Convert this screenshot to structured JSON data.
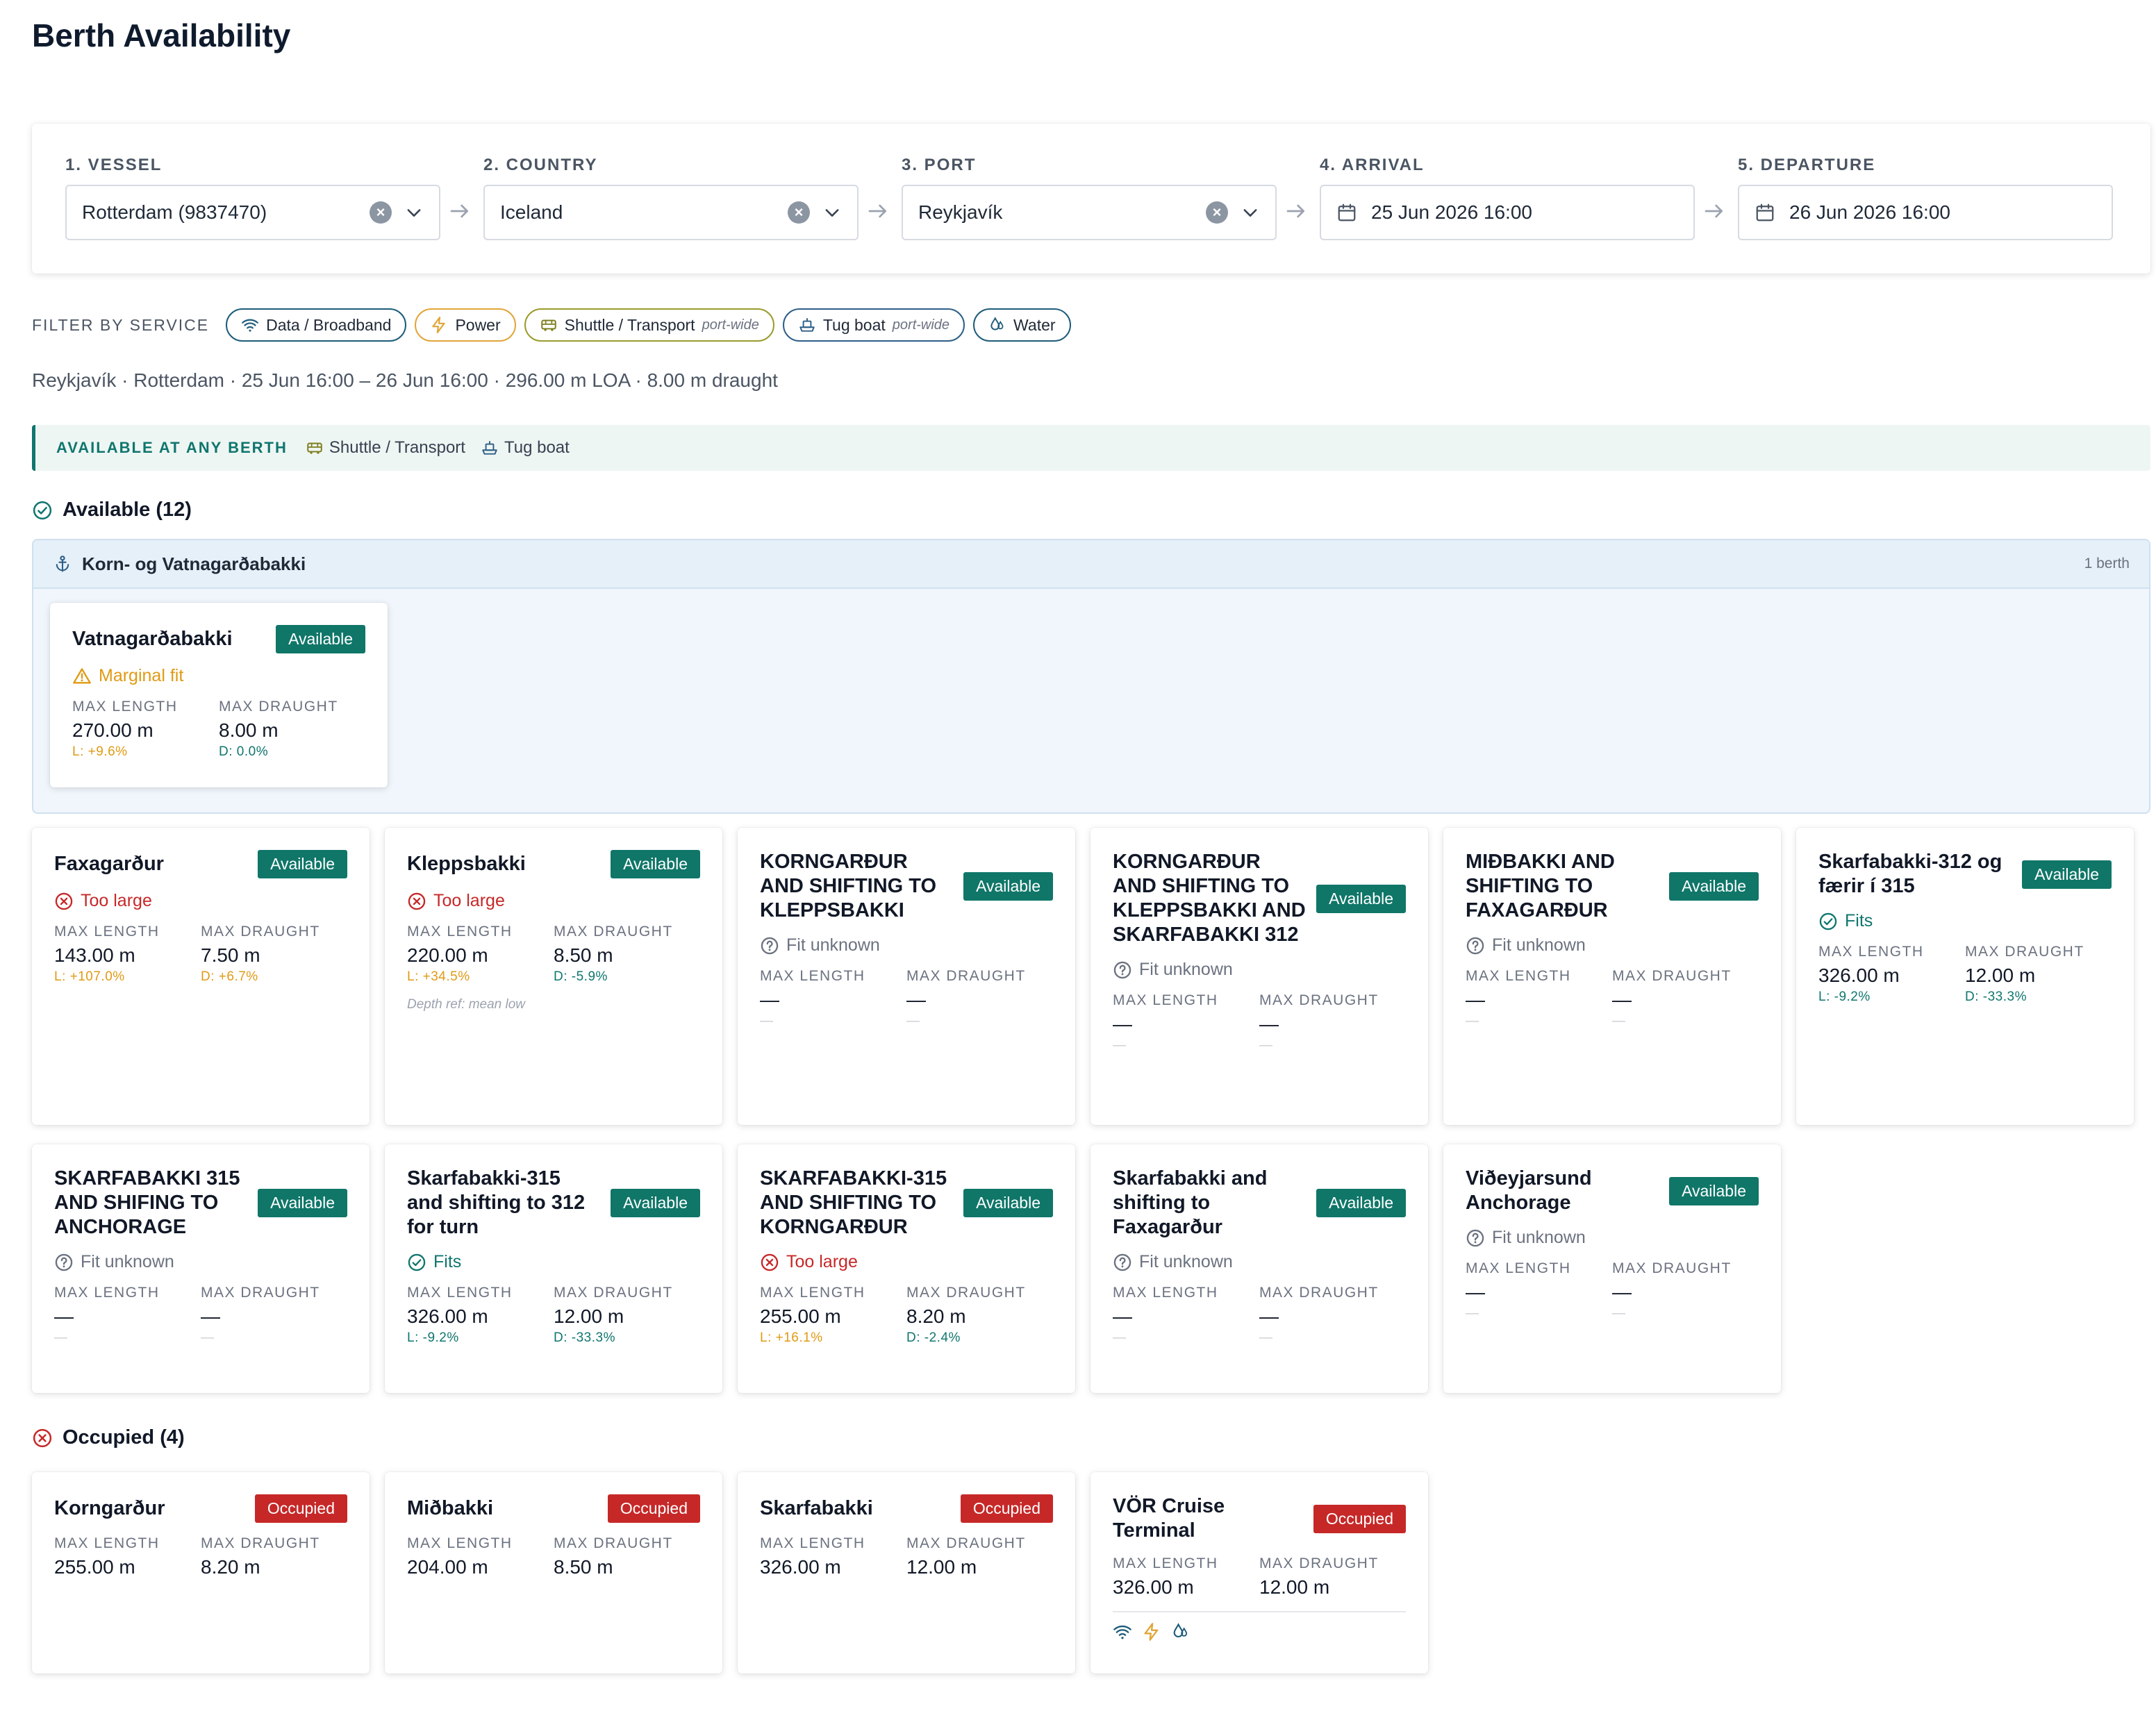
{
  "page": {
    "title": "Berth Availability"
  },
  "steps": [
    {
      "label": "1. VESSEL",
      "value": "Rotterdam (9837470)"
    },
    {
      "label": "2. COUNTRY",
      "value": "Iceland"
    },
    {
      "label": "3. PORT",
      "value": "Reykjavík"
    },
    {
      "label": "4. ARRIVAL",
      "value": "25 Jun 2026 16:00"
    },
    {
      "label": "5. DEPARTURE",
      "value": "26 Jun 2026 16:00"
    }
  ],
  "filter": {
    "label": "FILTER BY SERVICE",
    "chips": [
      {
        "label": "Data / Broadband",
        "icon": "wifi-icon"
      },
      {
        "label": "Power",
        "icon": "lightning-icon"
      },
      {
        "label": "Shuttle / Transport",
        "icon": "bus-icon",
        "note": "port-wide"
      },
      {
        "label": "Tug boat",
        "icon": "ship-icon",
        "note": "port-wide"
      },
      {
        "label": "Water",
        "icon": "water-drop-icon"
      }
    ]
  },
  "summary": "Reykjavík · Rotterdam · 25 Jun 16:00 – 26 Jun 16:00 · 296.00 m LOA · 8.00 m draught",
  "any_berth": {
    "label": "AVAILABLE AT ANY BERTH",
    "items": [
      {
        "label": "Shuttle / Transport",
        "icon": "bus-icon"
      },
      {
        "label": "Tug boat",
        "icon": "ship-icon"
      }
    ]
  },
  "available": {
    "heading": "Available (12)",
    "group": {
      "title": "Korn- og Vatnagarðabakki",
      "count": "1 berth",
      "card": {
        "name": "Vatnagarðabakki",
        "badge": "Available",
        "fit": "Marginal fit",
        "len_label": "MAX LENGTH",
        "len": "270.00 m",
        "len_delta": "L: +9.6%",
        "dr_label": "MAX DRAUGHT",
        "dr": "8.00 m",
        "dr_delta": "D: 0.0%"
      }
    },
    "cards": [
      {
        "name": "Faxagarður",
        "badge": "Available",
        "fit": "Too large",
        "len_label": "MAX LENGTH",
        "len": "143.00 m",
        "len_delta": "L: +107.0%",
        "dr_label": "MAX DRAUGHT",
        "dr": "7.50 m",
        "dr_delta": "D: +6.7%"
      },
      {
        "name": "Kleppsbakki",
        "badge": "Available",
        "fit": "Too large",
        "len_label": "MAX LENGTH",
        "len": "220.00 m",
        "len_delta": "L: +34.5%",
        "dr_label": "MAX DRAUGHT",
        "dr": "8.50 m",
        "dr_delta": "D: -5.9%",
        "depth_ref": "Depth ref: mean low"
      },
      {
        "name": "KORNGARÐUR AND SHIFTING TO KLEPPSBAKKI",
        "badge": "Available",
        "fit": "Fit unknown",
        "len_label": "MAX LENGTH",
        "len": "—",
        "len_delta": "—",
        "dr_label": "MAX DRAUGHT",
        "dr": "—",
        "dr_delta": "—"
      },
      {
        "name": "KORNGARÐUR AND SHIFTING TO KLEPPSBAKKI AND SKARFABAKKI 312",
        "badge": "Available",
        "fit": "Fit unknown",
        "len_label": "MAX LENGTH",
        "len": "—",
        "len_delta": "—",
        "dr_label": "MAX DRAUGHT",
        "dr": "—",
        "dr_delta": "—"
      },
      {
        "name": "MIÐBAKKI AND SHIFTING TO FAXAGARÐUR",
        "badge": "Available",
        "fit": "Fit unknown",
        "len_label": "MAX LENGTH",
        "len": "—",
        "len_delta": "—",
        "dr_label": "MAX DRAUGHT",
        "dr": "—",
        "dr_delta": "—"
      },
      {
        "name": "Skarfabakki-312 og færir í 315",
        "badge": "Available",
        "fit": "Fits",
        "len_label": "MAX LENGTH",
        "len": "326.00 m",
        "len_delta": "L: -9.2%",
        "dr_label": "MAX DRAUGHT",
        "dr": "12.00 m",
        "dr_delta": "D: -33.3%"
      },
      {
        "name": "SKARFABAKKI 315 AND SHIFING TO ANCHORAGE",
        "badge": "Available",
        "fit": "Fit unknown",
        "len_label": "MAX LENGTH",
        "len": "—",
        "len_delta": "—",
        "dr_label": "MAX DRAUGHT",
        "dr": "—",
        "dr_delta": "—"
      },
      {
        "name": "Skarfabakki-315 and shifting to 312 for turn",
        "badge": "Available",
        "fit": "Fits",
        "len_label": "MAX LENGTH",
        "len": "326.00 m",
        "len_delta": "L: -9.2%",
        "dr_label": "MAX DRAUGHT",
        "dr": "12.00 m",
        "dr_delta": "D: -33.3%"
      },
      {
        "name": "SKARFABAKKI-315 AND SHIFTING TO KORNGARÐUR",
        "badge": "Available",
        "fit": "Too large",
        "len_label": "MAX LENGTH",
        "len": "255.00 m",
        "len_delta": "L: +16.1%",
        "dr_label": "MAX DRAUGHT",
        "dr": "8.20 m",
        "dr_delta": "D: -2.4%"
      },
      {
        "name": "Skarfabakki and shifting to Faxagarður",
        "badge": "Available",
        "fit": "Fit unknown",
        "len_label": "MAX LENGTH",
        "len": "—",
        "len_delta": "—",
        "dr_label": "MAX DRAUGHT",
        "dr": "—",
        "dr_delta": "—"
      },
      {
        "name": "Viðeyjarsund Anchorage",
        "badge": "Available",
        "fit": "Fit unknown",
        "len_label": "MAX LENGTH",
        "len": "—",
        "len_delta": "—",
        "dr_label": "MAX DRAUGHT",
        "dr": "—",
        "dr_delta": "—"
      }
    ]
  },
  "occupied": {
    "heading": "Occupied (4)",
    "cards": [
      {
        "name": "Korngarður",
        "badge": "Occupied",
        "len_label": "MAX LENGTH",
        "len": "255.00 m",
        "dr_label": "MAX DRAUGHT",
        "dr": "8.20 m"
      },
      {
        "name": "Miðbakki",
        "badge": "Occupied",
        "len_label": "MAX LENGTH",
        "len": "204.00 m",
        "dr_label": "MAX DRAUGHT",
        "dr": "8.50 m"
      },
      {
        "name": "Skarfabakki",
        "badge": "Occupied",
        "len_label": "MAX LENGTH",
        "len": "326.00 m",
        "dr_label": "MAX DRAUGHT",
        "dr": "12.00 m"
      },
      {
        "name": "VÖR Cruise Terminal",
        "badge": "Occupied",
        "len_label": "MAX LENGTH",
        "len": "326.00 m",
        "dr_label": "MAX DRAUGHT",
        "dr": "12.00 m",
        "services": [
          "wifi-icon",
          "lightning-icon",
          "water-drop-icon"
        ]
      }
    ]
  },
  "colors": {
    "accent": "#0f7668",
    "occupied": "#c62828",
    "marginal": "#e09a14",
    "too_large": "#c62828",
    "unknown": "#6b7280"
  }
}
